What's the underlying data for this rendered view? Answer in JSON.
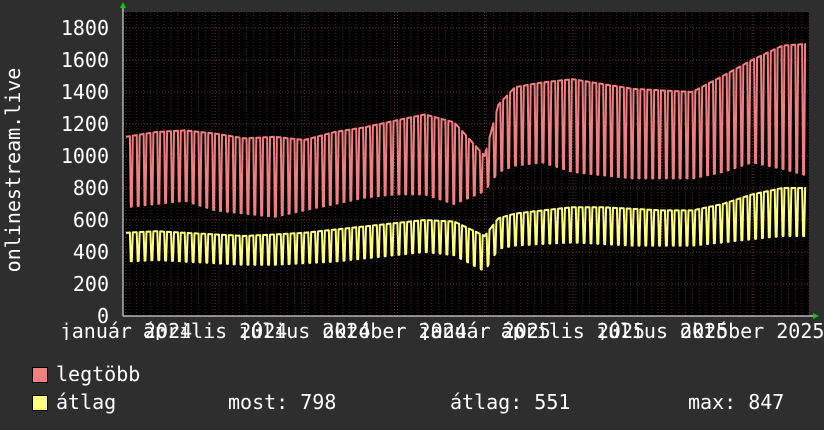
{
  "chart_data": {
    "type": "line",
    "ylabel": "onlinestream.live",
    "ylim": [
      0,
      1900
    ],
    "yticks": [
      0,
      200,
      400,
      600,
      800,
      1000,
      1200,
      1400,
      1600,
      1800
    ],
    "xticks": [
      "január 2024",
      "április 2024",
      "július 2024",
      "október 2024",
      "január 2025",
      "április 2025",
      "július 2025",
      "október 2025"
    ],
    "x_range": [
      "2023-12-29",
      "2025-11-28"
    ],
    "grid": true,
    "series": [
      {
        "name": "legtöbb",
        "color": "#f07f7f",
        "x": [
          "2024-01-01",
          "2024-02-01",
          "2024-03-01",
          "2024-04-01",
          "2024-05-01",
          "2024-06-01",
          "2024-07-01",
          "2024-08-01",
          "2024-09-01",
          "2024-10-01",
          "2024-11-01",
          "2024-12-01",
          "2025-01-01",
          "2025-01-15",
          "2025-02-01",
          "2025-03-01",
          "2025-04-01",
          "2025-05-01",
          "2025-06-01",
          "2025-07-01",
          "2025-08-01",
          "2025-09-01",
          "2025-10-01",
          "2025-11-01",
          "2025-11-25"
        ],
        "weekday_values": [
          1120,
          1150,
          1160,
          1140,
          1110,
          1120,
          1100,
          1150,
          1180,
          1220,
          1260,
          1210,
          1000,
          1320,
          1430,
          1460,
          1480,
          1450,
          1420,
          1410,
          1400,
          1500,
          1600,
          1690,
          1700
        ],
        "weekend_values": [
          680,
          700,
          720,
          660,
          640,
          620,
          660,
          700,
          740,
          760,
          760,
          700,
          780,
          900,
          940,
          960,
          900,
          880,
          860,
          860,
          860,
          900,
          960,
          920,
          880
        ]
      },
      {
        "name": "átlag",
        "color": "#ffff80",
        "x": [
          "2024-01-01",
          "2024-02-01",
          "2024-03-01",
          "2024-04-01",
          "2024-05-01",
          "2024-06-01",
          "2024-07-01",
          "2024-08-01",
          "2024-09-01",
          "2024-10-01",
          "2024-11-01",
          "2024-12-01",
          "2025-01-01",
          "2025-01-15",
          "2025-02-01",
          "2025-03-01",
          "2025-04-01",
          "2025-05-01",
          "2025-06-01",
          "2025-07-01",
          "2025-08-01",
          "2025-09-01",
          "2025-10-01",
          "2025-11-01",
          "2025-11-25"
        ],
        "weekday_values": [
          520,
          530,
          520,
          510,
          500,
          510,
          520,
          540,
          560,
          580,
          600,
          590,
          500,
          610,
          640,
          660,
          680,
          680,
          670,
          660,
          660,
          700,
          760,
          800,
          800
        ],
        "weekend_values": [
          340,
          350,
          340,
          330,
          320,
          320,
          330,
          340,
          360,
          380,
          400,
          380,
          280,
          420,
          440,
          450,
          460,
          450,
          440,
          440,
          440,
          460,
          480,
          500,
          500
        ]
      }
    ],
    "legend_position": "bottom-left"
  },
  "legend": {
    "max_label": "legtöbb",
    "avg_label": "átlag",
    "now_text": "most: 798",
    "avg_text": "átlag: 551",
    "peak_text": "max: 847"
  }
}
